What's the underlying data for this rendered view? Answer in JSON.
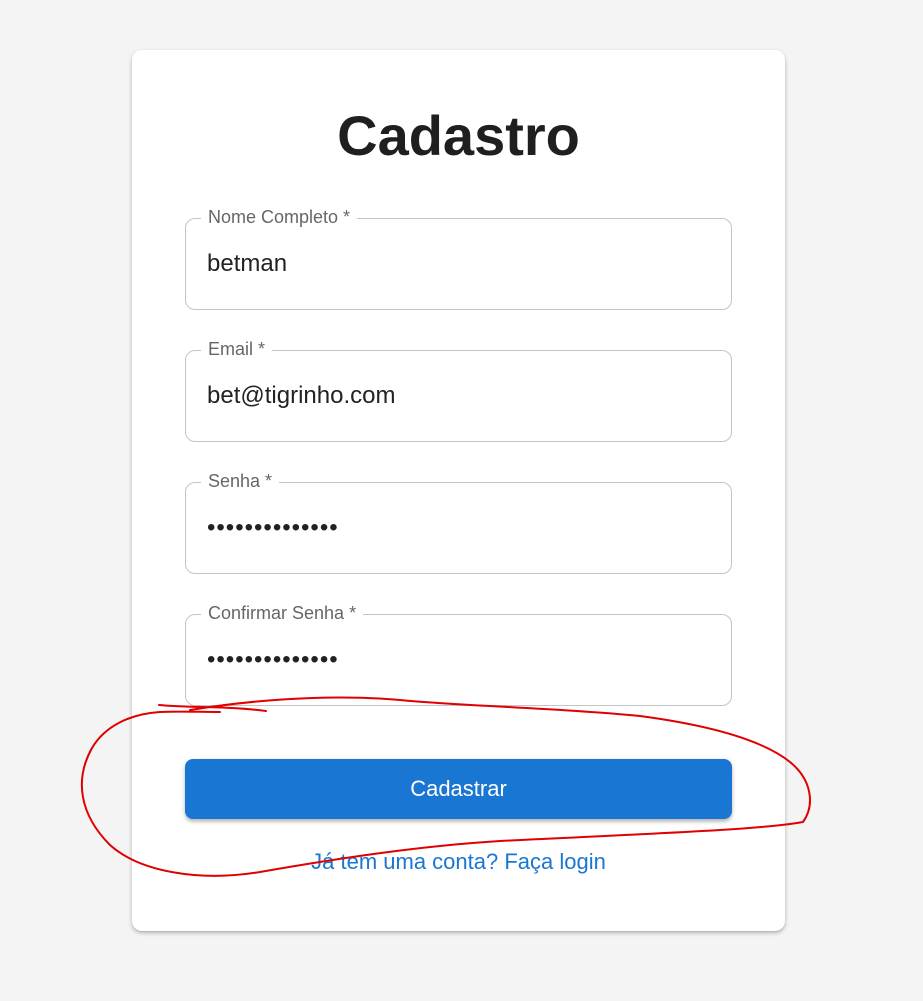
{
  "form": {
    "title": "Cadastro",
    "fields": [
      {
        "label": "Nome Completo *",
        "value": "betman",
        "type": "text"
      },
      {
        "label": "Email *",
        "value": "bet@tigrinho.com",
        "type": "email"
      },
      {
        "label": "Senha *",
        "value": "••••••••••••••",
        "type": "password"
      },
      {
        "label": "Confirmar Senha *",
        "value": "••••••••••••••",
        "type": "password"
      }
    ],
    "submit_label": "Cadastrar",
    "login_link": "Já tem uma conta? Faça login"
  },
  "colors": {
    "page_background": "#f4f4f4",
    "card_background": "#ffffff",
    "primary": "#1976d2",
    "annotation": "#e00000"
  }
}
